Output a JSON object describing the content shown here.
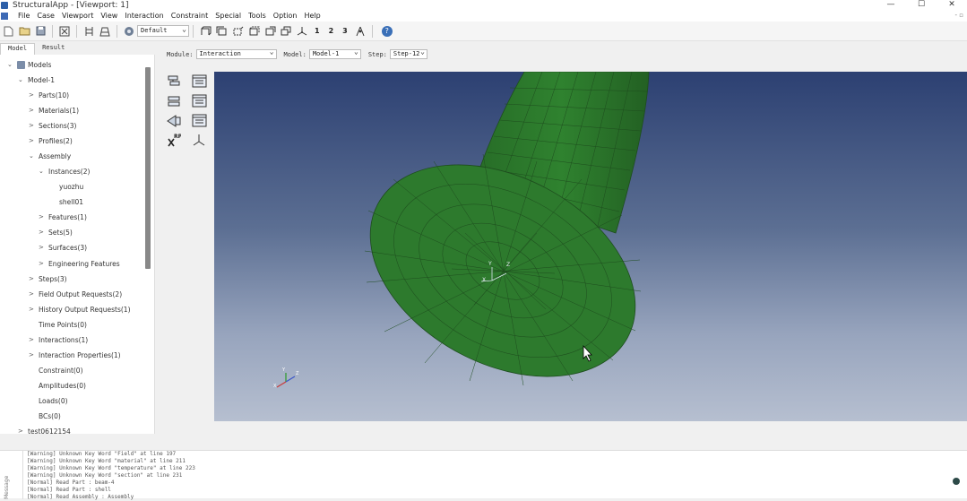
{
  "window": {
    "title": "StructuralApp - [Viewport: 1]",
    "controls": [
      "—",
      "☐",
      "✕"
    ]
  },
  "menu": {
    "items": [
      "File",
      "Case",
      "Viewport",
      "View",
      "Interaction",
      "Constraint",
      "Special",
      "Tools",
      "Option",
      "Help"
    ],
    "right": "- ▫"
  },
  "toolbar": {
    "render_style": "Default",
    "view_numbers": [
      "1",
      "2",
      "3"
    ]
  },
  "tabs": [
    "Model",
    "Result"
  ],
  "tree": {
    "rows": [
      {
        "label": "Models",
        "arrow": "⌄",
        "indent": 0,
        "icon": true
      },
      {
        "label": "Model-1",
        "arrow": "⌄",
        "indent": 1
      },
      {
        "label": "Parts(10)",
        "arrow": ">",
        "indent": 2
      },
      {
        "label": "Materials(1)",
        "arrow": ">",
        "indent": 2
      },
      {
        "label": "Sections(3)",
        "arrow": ">",
        "indent": 2
      },
      {
        "label": "Profiles(2)",
        "arrow": ">",
        "indent": 2
      },
      {
        "label": "Assembly",
        "arrow": "⌄",
        "indent": 2
      },
      {
        "label": "Instances(2)",
        "arrow": "⌄",
        "indent": 3
      },
      {
        "label": "yuozhu",
        "arrow": "",
        "indent": 4
      },
      {
        "label": "shell01",
        "arrow": "",
        "indent": 4
      },
      {
        "label": "Features(1)",
        "arrow": ">",
        "indent": 3
      },
      {
        "label": "Sets(5)",
        "arrow": ">",
        "indent": 3
      },
      {
        "label": "Surfaces(3)",
        "arrow": ">",
        "indent": 3
      },
      {
        "label": "Engineering Features",
        "arrow": ">",
        "indent": 3
      },
      {
        "label": "Steps(3)",
        "arrow": ">",
        "indent": 2
      },
      {
        "label": "Field Output Requests(2)",
        "arrow": ">",
        "indent": 2
      },
      {
        "label": "History Output Requests(1)",
        "arrow": ">",
        "indent": 2
      },
      {
        "label": "Time Points(0)",
        "arrow": "",
        "indent": 2
      },
      {
        "label": "Interactions(1)",
        "arrow": ">",
        "indent": 2
      },
      {
        "label": "Interaction Properties(1)",
        "arrow": ">",
        "indent": 2
      },
      {
        "label": "Constraint(0)",
        "arrow": "",
        "indent": 2
      },
      {
        "label": "Amplitudes(0)",
        "arrow": "",
        "indent": 2
      },
      {
        "label": "Loads(0)",
        "arrow": "",
        "indent": 2
      },
      {
        "label": "BCs(0)",
        "arrow": "",
        "indent": 2
      },
      {
        "label": "test0612154",
        "arrow": ">",
        "indent": 1
      }
    ]
  },
  "context": {
    "module_label": "Module:",
    "module_value": "Interaction",
    "model_label": "Model:",
    "model_value": "Model-1",
    "step_label": "Step:",
    "step_value": "Step-12"
  },
  "viewport": {
    "triad": {
      "x": "X",
      "y": "Y",
      "z": "Z"
    },
    "mesh_color": "#2e7d2e"
  },
  "messages": {
    "side_label": "Message",
    "lines": [
      "[Warning] Unknown Key Word \"Field\" at line 197",
      "[Warning] Unknown Key Word \"material\" at line 211",
      "[Warning] Unknown Key Word \"temperature\" at line 223",
      "[Warning] Unknown Key Word \"section\" at line 231",
      "[Normal] Read Part : beam-4",
      "[Normal] Read Part : shell",
      "[Normal] Read Assembly : Assembly"
    ]
  }
}
